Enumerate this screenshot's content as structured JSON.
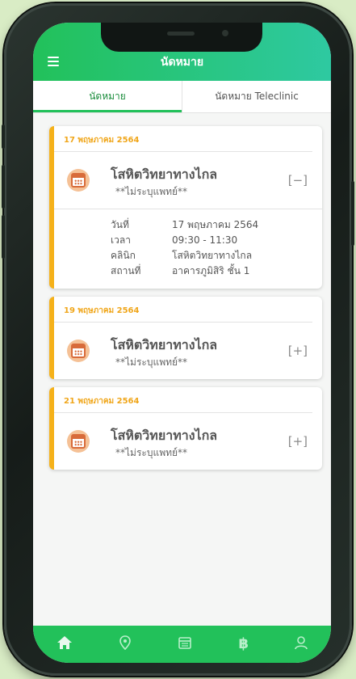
{
  "header": {
    "title": "นัดหมาย",
    "menu_icon": "hamburger-icon"
  },
  "tabs": [
    {
      "label": "นัดหมาย",
      "active": true
    },
    {
      "label": "นัดหมาย Teleclinic",
      "active": false
    }
  ],
  "appointments": [
    {
      "date": "17 พฤษภาคม 2564",
      "clinic": "โสหิตวิทยาทางไกล",
      "doctor": "**ไม่ระบุแพทย์**",
      "toggle": "[−]",
      "expanded": true,
      "details": [
        {
          "label": "วันที่",
          "value": "17 พฤษภาคม 2564"
        },
        {
          "label": "เวลา",
          "value": "09:30 - 11:30"
        },
        {
          "label": "คลินิก",
          "value": "โสหิตวิทยาทางไกล"
        },
        {
          "label": "สถานที่",
          "value": "อาคารภูมิสิริ ชั้น 1"
        }
      ]
    },
    {
      "date": "19 พฤษภาคม 2564",
      "clinic": "โสหิตวิทยาทางไกล",
      "doctor": "**ไม่ระบุแพทย์**",
      "toggle": "[+]",
      "expanded": false
    },
    {
      "date": "21 พฤษภาคม 2564",
      "clinic": "โสหิตวิทยาทางไกล",
      "doctor": "**ไม่ระบุแพทย์**",
      "toggle": "[+]",
      "expanded": false
    }
  ],
  "bottom_nav": [
    {
      "icon": "home-icon",
      "active": true
    },
    {
      "icon": "location-pin-icon",
      "active": false
    },
    {
      "icon": "calendar-icon",
      "active": false
    },
    {
      "icon": "baht-icon",
      "active": false
    },
    {
      "icon": "profile-icon",
      "active": false
    }
  ],
  "colors": {
    "header_start": "#22c15a",
    "header_end": "#2ec9a1",
    "accent": "#f5b11a",
    "nav": "#22c15a"
  }
}
